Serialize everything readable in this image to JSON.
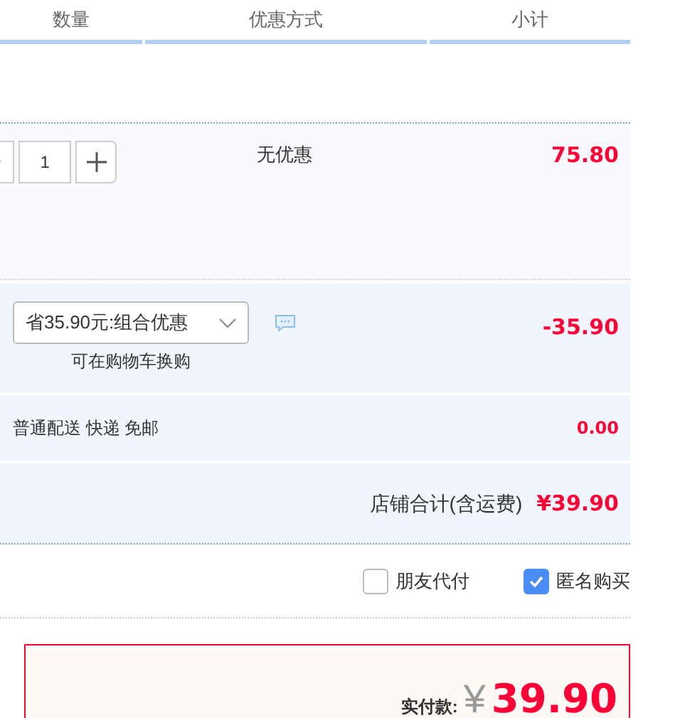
{
  "columns": [
    {
      "label": "数量"
    },
    {
      "label": "优惠方式"
    },
    {
      "label": "小计"
    }
  ],
  "item": {
    "quantity": "1",
    "discount": "无优惠",
    "subtotal": "75.80"
  },
  "promotion": {
    "select": "省35.90元:组合优惠",
    "note": "可在购物车换购",
    "amount": "-35.90"
  },
  "shipping": {
    "method": "普通配送 快递 免邮",
    "amount": "0.00"
  },
  "shop_total": {
    "label": "店铺合计(含运费)",
    "amount": "¥39.90"
  },
  "options": [
    {
      "label": "朋友代付",
      "checked": false
    },
    {
      "label": "匿名购买",
      "checked": true
    }
  ],
  "payment": {
    "label": "实付款:",
    "currency": "¥",
    "amount": "39.90"
  }
}
